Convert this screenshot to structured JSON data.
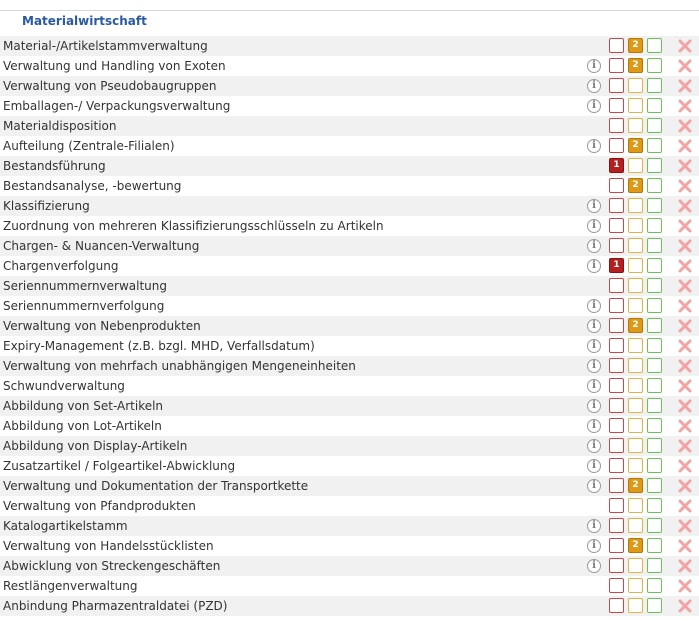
{
  "section": {
    "title": "Materialwirtschaft"
  },
  "rows": [
    {
      "label": "Material-/Artikelstammverwaltung",
      "info": false,
      "level": 2
    },
    {
      "label": "Verwaltung und Handling von Exoten",
      "info": true,
      "level": 2
    },
    {
      "label": "Verwaltung von Pseudobaugruppen",
      "info": true,
      "level": 0
    },
    {
      "label": "Emballagen-/ Verpackungsverwaltung",
      "info": true,
      "level": 0
    },
    {
      "label": "Materialdisposition",
      "info": false,
      "level": 0
    },
    {
      "label": "Aufteilung (Zentrale-Filialen)",
      "info": true,
      "level": 2
    },
    {
      "label": "Bestandsführung",
      "info": false,
      "level": 1
    },
    {
      "label": "Bestandsanalyse, -bewertung",
      "info": false,
      "level": 2
    },
    {
      "label": "Klassifizierung",
      "info": true,
      "level": 0
    },
    {
      "label": "Zuordnung von mehreren Klassifizierungsschlüsseln zu Artikeln",
      "info": true,
      "level": 0
    },
    {
      "label": "Chargen- & Nuancen-Verwaltung",
      "info": true,
      "level": 0
    },
    {
      "label": "Chargenverfolgung",
      "info": true,
      "level": 1
    },
    {
      "label": "Seriennummernverwaltung",
      "info": false,
      "level": 0
    },
    {
      "label": "Seriennummernverfolgung",
      "info": true,
      "level": 0
    },
    {
      "label": "Verwaltung von Nebenprodukten",
      "info": true,
      "level": 2
    },
    {
      "label": "Expiry-Management (z.B. bzgl. MHD, Verfallsdatum)",
      "info": true,
      "level": 0
    },
    {
      "label": "Verwaltung von mehrfach unabhängigen Mengeneinheiten",
      "info": true,
      "level": 0
    },
    {
      "label": "Schwundverwaltung",
      "info": true,
      "level": 0
    },
    {
      "label": "Abbildung von Set-Artikeln",
      "info": true,
      "level": 0
    },
    {
      "label": "Abbildung von Lot-Artikeln",
      "info": true,
      "level": 0
    },
    {
      "label": "Abbildung von Display-Artikeln",
      "info": true,
      "level": 0
    },
    {
      "label": "Zusatzartikel / Folgeartikel-Abwicklung",
      "info": true,
      "level": 0
    },
    {
      "label": "Verwaltung und Dokumentation der Transportkette",
      "info": true,
      "level": 2
    },
    {
      "label": "Verwaltung von Pfandprodukten",
      "info": false,
      "level": 0
    },
    {
      "label": "Katalogartikelstamm",
      "info": true,
      "level": 0
    },
    {
      "label": "Verwaltung von Handelsstücklisten",
      "info": true,
      "level": 2
    },
    {
      "label": "Abwicklung von Streckengeschäften",
      "info": true,
      "level": 0
    },
    {
      "label": "Restlängenverwaltung",
      "info": false,
      "level": 0
    },
    {
      "label": "Anbindung Pharmazentraldatei (PZD)",
      "info": false,
      "level": 0
    }
  ],
  "badges": {
    "one": "1",
    "two": "2",
    "info": "i"
  },
  "colors": {
    "title": "#2a5aa0",
    "priority1": "#b51f1f",
    "priority2": "#dc9a17",
    "priority3": "#6cbf5a",
    "delete": "#f2a3a3"
  }
}
